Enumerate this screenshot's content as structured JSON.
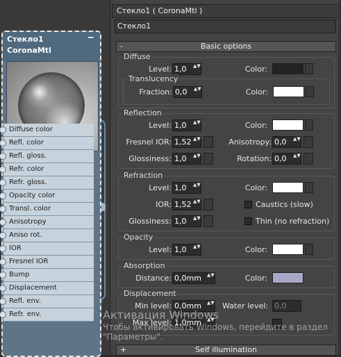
{
  "node": {
    "title_line1": "Стекло1",
    "title_line2": "CoronaMtl",
    "collapse_glyph": "−",
    "sockets": [
      "Diffuse color",
      "Refl. color",
      "Refl. gloss.",
      "Refr. color",
      "Refr. gloss.",
      "Opacity color",
      "Transl. color",
      "Anisotropy",
      "Aniso rot.",
      "IOR",
      "Fresnel IOR",
      "Bump",
      "Displacement",
      "Refl. env.",
      "Refr. env."
    ]
  },
  "panel": {
    "title": "Стекло1  ( CoronaMtl )",
    "name_value": "Стекло1",
    "basic_options": {
      "toggle": "-",
      "label": "Basic options"
    },
    "diffuse": {
      "title": "Diffuse",
      "level_label": "Level:",
      "level": "1,0",
      "color_label": "Color:",
      "color": "#232323",
      "translucency": {
        "title": "Translucency",
        "fraction_label": "Fraction:",
        "fraction": "0,0",
        "color_label": "Color:",
        "color": "#ffffff"
      }
    },
    "reflection": {
      "title": "Reflection",
      "level_label": "Level:",
      "level": "1,0",
      "color_label": "Color:",
      "color": "#ffffff",
      "fresnel_label": "Fresnel IOR:",
      "fresnel": "1,52",
      "aniso_label": "Anisotropy:",
      "aniso": "0,0",
      "gloss_label": "Glossiness:",
      "gloss": "1,0",
      "rotation_label": "Rotation:",
      "rotation": "0,0"
    },
    "refraction": {
      "title": "Refraction",
      "level_label": "Level:",
      "level": "1,0",
      "color_label": "Color:",
      "color": "#ffffff",
      "ior_label": "IOR:",
      "ior": "1,52",
      "gloss_label": "Glossiness:",
      "gloss": "1,0",
      "caustics_label": "Caustics (slow)",
      "thin_label": "Thin (no refraction)"
    },
    "opacity": {
      "title": "Opacity",
      "level_label": "Level:",
      "level": "1,0",
      "color_label": "Color:",
      "color": "#ffffff"
    },
    "absorption": {
      "title": "Absorption",
      "distance_label": "Distance:",
      "distance": "0,0mm",
      "color_label": "Color:",
      "color": "#a9a7c6"
    },
    "displacement": {
      "title": "Displacement",
      "min_label": "Min level:",
      "min": "0,0mm",
      "water_label": "Water level:",
      "water": "0,0",
      "max_label": "Max level:",
      "max": "1,0mm"
    },
    "self_illumination": {
      "toggle": "+",
      "label": "Self illumination"
    }
  },
  "watermark": {
    "title": "Активация Windows",
    "body": "Чтобы активировать Windows, перейдите в раздел \"Параметры\"."
  },
  "spinner_glyph": "▲▼",
  "colors": {
    "node_header": "#4f697f",
    "socket_bg": "#c7d3dc",
    "panel_bg": "#444444"
  }
}
